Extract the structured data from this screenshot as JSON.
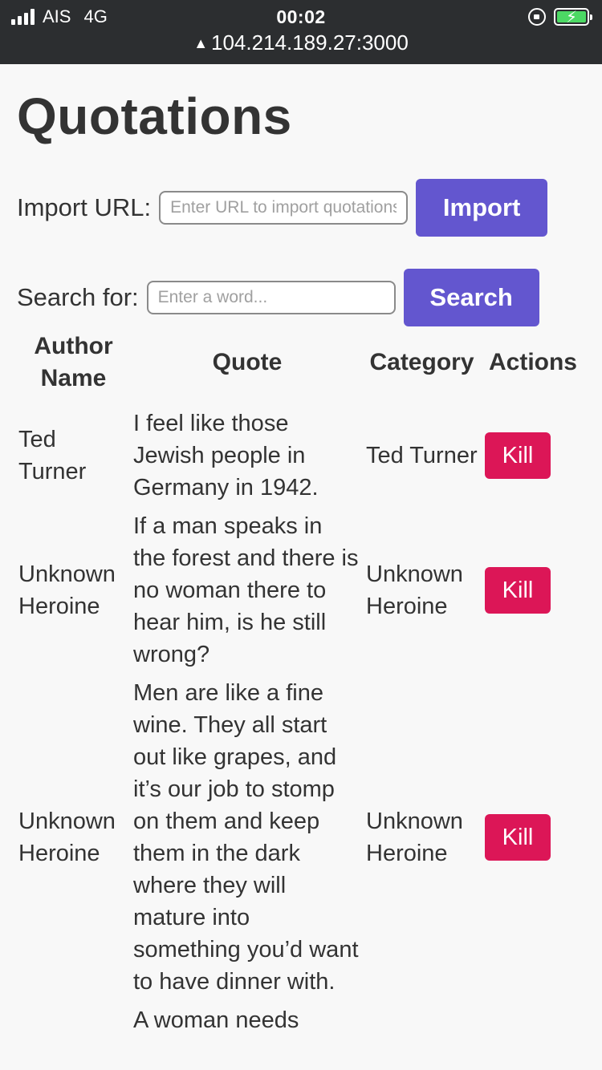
{
  "status_bar": {
    "carrier": "AIS",
    "network": "4G",
    "time": "00:02",
    "url": "104.214.189.27:3000",
    "icons": [
      "signal-icon",
      "warning-icon",
      "rotation-lock-icon",
      "battery-charging-icon"
    ],
    "battery_color": "#4cd964"
  },
  "page": {
    "title": "Quotations"
  },
  "import_form": {
    "label": "Import URL:",
    "placeholder": "Enter URL to import quotations",
    "value": "",
    "button_label": "Import"
  },
  "search_form": {
    "label": "Search for:",
    "placeholder": "Enter a word...",
    "value": "",
    "button_label": "Search"
  },
  "table": {
    "headers": [
      "Author Name",
      "Quote",
      "Category",
      "Actions"
    ],
    "rows": [
      {
        "author": "Ted Turner",
        "quote": "I feel like those Jewish people in Germany in 1942.",
        "category": "Ted Turner",
        "action": "Kill"
      },
      {
        "author": "Unknown Heroine",
        "quote": "If a man speaks in the forest and there is no woman there to hear him, is he still wrong?",
        "category": "Unknown Heroine",
        "action": "Kill"
      },
      {
        "author": "Unknown Heroine",
        "quote": "Men are like a fine wine. They all start out like grapes, and it’s our job to stomp on them and keep them in the dark where they will mature into something you’d want to have dinner with.",
        "category": "Unknown Heroine",
        "action": "Kill"
      },
      {
        "author": "",
        "quote": "A woman needs",
        "category": "",
        "action": ""
      }
    ]
  },
  "colors": {
    "primary_button": "#6356cf",
    "danger_button": "#dc1657",
    "status_bar_bg": "#2c2e30",
    "page_bg": "#f8f8f8"
  }
}
